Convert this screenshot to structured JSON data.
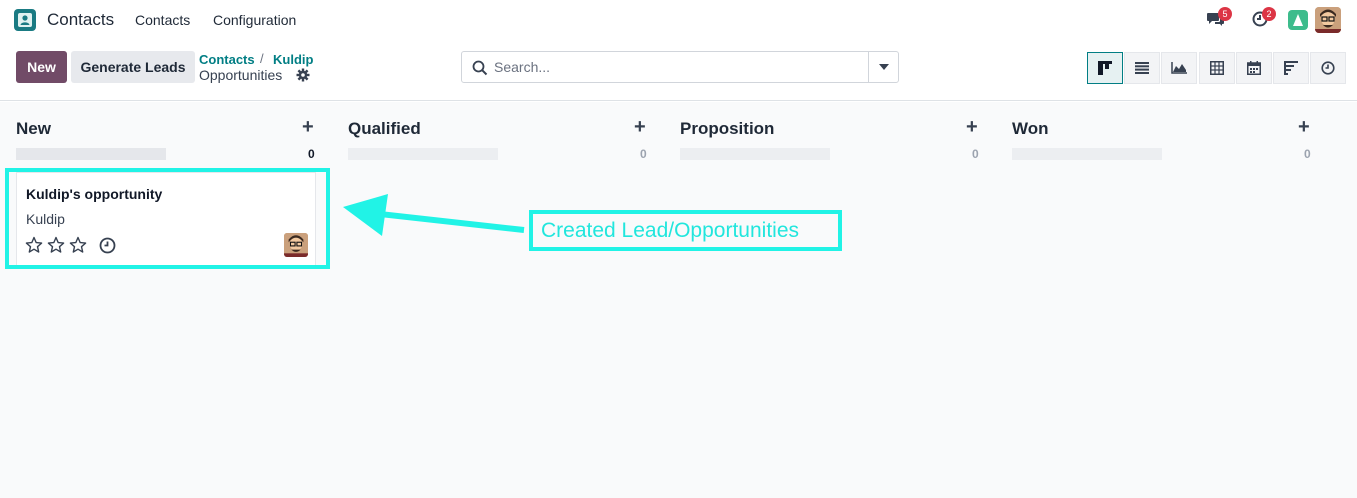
{
  "navbar": {
    "app_name": "Contacts",
    "menu": [
      "Contacts",
      "Configuration"
    ],
    "messages_badge": "5",
    "activities_badge": "2"
  },
  "control_panel": {
    "new_label": "New",
    "generate_leads_label": "Generate Leads",
    "breadcrumbs": [
      "Contacts",
      "Kuldip"
    ],
    "breadcrumb_separator": "/",
    "current_view": "Opportunities",
    "search_placeholder": "Search...",
    "views": [
      "kanban",
      "list",
      "graph",
      "pivot",
      "calendar",
      "cohort",
      "activity"
    ]
  },
  "kanban": {
    "columns": [
      {
        "title": "New",
        "count": "0"
      },
      {
        "title": "Qualified",
        "count": "0"
      },
      {
        "title": "Proposition",
        "count": "0"
      },
      {
        "title": "Won",
        "count": "0"
      }
    ],
    "card": {
      "title": "Kuldip's opportunity",
      "subtitle": "Kuldip",
      "stars": 0
    }
  },
  "annotation": {
    "label": "Created Lead/Opportunities",
    "color": "#21f3e6"
  }
}
